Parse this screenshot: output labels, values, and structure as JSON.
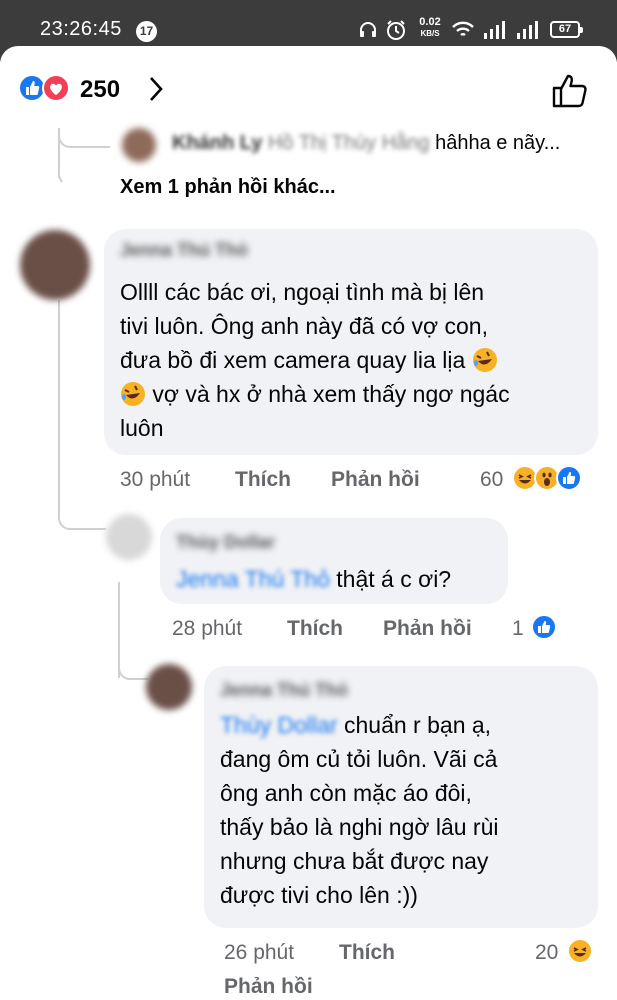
{
  "status_bar": {
    "time": "23:26:45",
    "notification_count": "17",
    "net_speed_value": "0.02",
    "net_speed_unit": "KB/S",
    "battery": "67"
  },
  "header": {
    "reaction_icons": [
      "like-icon",
      "love-icon"
    ],
    "reaction_count": "250"
  },
  "top_reply": {
    "author": "Khánh Ly",
    "mention": "Hồ Thị Thùy Hằng",
    "text": "hâhha e nãy..."
  },
  "see_more_label": "Xem 1 phản hồi khác...",
  "comments": [
    {
      "author": "Jenna Thú Thỏ",
      "text_lines": [
        "Ollll các bác ơi, ngoại tình mà bị lên",
        "tivi luôn. Ông anh này đã có vợ con,",
        "đưa bồ đi xem camera quay lia lịa",
        "vợ và hx ở nhà xem thấy ngơ ngác",
        "luôn"
      ],
      "emoji_inline": [
        "rolling-laugh-emoji",
        "rolling-laugh-emoji"
      ],
      "time": "30 phút",
      "like_label": "Thích",
      "reply_label": "Phản hồi",
      "reaction_count": "60",
      "reactions": [
        "haha-icon",
        "wow-icon",
        "like-icon"
      ]
    },
    {
      "author": "Thùy Dollar",
      "mention": "Jenna Thú Thỏ",
      "text": "thật á c ơi?",
      "time": "28 phút",
      "like_label": "Thích",
      "reply_label": "Phản hồi",
      "reaction_count": "1",
      "reactions": [
        "like-icon"
      ]
    },
    {
      "author": "Jenna Thú Thỏ",
      "mention": "Thùy Dollar",
      "text_first": "chuẩn r bạn ạ,",
      "text_lines": [
        "đang ôm củ tỏi luôn. Vãi cả",
        "ông anh còn mặc áo đôi,",
        "thấy bảo là nghi ngờ lâu rùi",
        "nhưng chưa bắt được nay",
        "được tivi cho lên :))"
      ],
      "time": "26 phút",
      "like_label": "Thích",
      "reply_label": "Phản hồi",
      "reaction_count": "20",
      "reactions": [
        "haha-icon"
      ]
    }
  ],
  "colors": {
    "like_blue": "#1877f2",
    "love_red": "#f33e58",
    "haha_yellow": "#f7b125",
    "bubble_gray": "#f0f2f5",
    "meta_gray": "#65676b"
  }
}
